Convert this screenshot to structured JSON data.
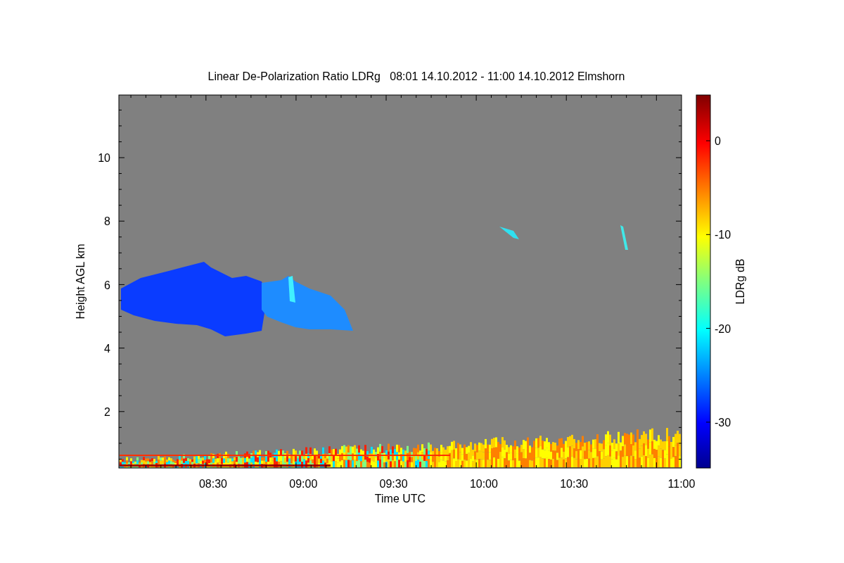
{
  "title": "Linear De-Polarization Ratio LDRg   08:01 14.10.2012 - 11:00 14.10.2012 Elmshorn",
  "y_axis": {
    "label": "Height AGL km",
    "ticks": [
      "10",
      "8",
      "6",
      "4",
      "2"
    ]
  },
  "x_axis": {
    "label": "Time UTC",
    "ticks": [
      "08:30",
      "09:00",
      "09:30",
      "10:00",
      "10:30",
      "11:00"
    ]
  },
  "colorbar": {
    "label": "LDRg dB",
    "ticks": [
      "0",
      "-10",
      "-20",
      "-30"
    ]
  }
}
